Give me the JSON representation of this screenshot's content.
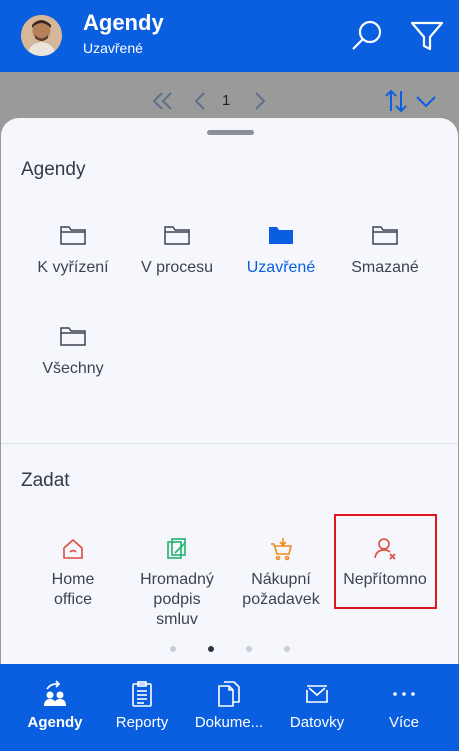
{
  "header": {
    "title": "Agendy",
    "subtitle": "Uzavřené",
    "colors": {
      "primary": "#0a5fe0"
    }
  },
  "pager": {
    "first_icon": "double-chevron-left-icon",
    "prev_icon": "chevron-left-icon",
    "current_page": "1",
    "next_icon": "chevron-right-icon",
    "sort_icon": "sort-arrows-icon",
    "expand_icon": "chevron-down-icon"
  },
  "agendas": {
    "title": "Agendy",
    "items": [
      {
        "label": "K vyřízení",
        "icon": "folder-icon",
        "active": false
      },
      {
        "label": "V procesu",
        "icon": "folder-icon",
        "active": false
      },
      {
        "label": "Uzavřené",
        "icon": "folder-filled-icon",
        "active": true
      },
      {
        "label": "Smazané",
        "icon": "folder-icon",
        "active": false
      },
      {
        "label": "Všechny",
        "icon": "folder-icon",
        "active": false
      }
    ]
  },
  "create": {
    "title": "Zadat",
    "items": [
      {
        "label_lines": [
          "Home",
          "office"
        ],
        "icon": "home-icon",
        "color": "#e04a3c"
      },
      {
        "label_lines": [
          "Hromadný",
          "podpis",
          "smluv"
        ],
        "icon": "bulk-sign-icon",
        "color": "#22b36c"
      },
      {
        "label_lines": [
          "Nákupní",
          "požadavek"
        ],
        "icon": "cart-icon",
        "color": "#f08a1c"
      },
      {
        "label_lines": [
          "Nepřítomno"
        ],
        "icon": "person-absent-icon",
        "color": "#e04a3c"
      }
    ],
    "page_count": 4,
    "active_page": 1
  },
  "tabbar": {
    "items": [
      {
        "label": "Agendy",
        "icon": "agendas-icon",
        "active": true
      },
      {
        "label": "Reporty",
        "icon": "clipboard-icon",
        "active": false
      },
      {
        "label": "Dokume...",
        "icon": "documents-icon",
        "active": false
      },
      {
        "label": "Datovky",
        "icon": "data-box-icon",
        "active": false
      },
      {
        "label": "Více",
        "icon": "more-icon",
        "active": false
      }
    ]
  }
}
